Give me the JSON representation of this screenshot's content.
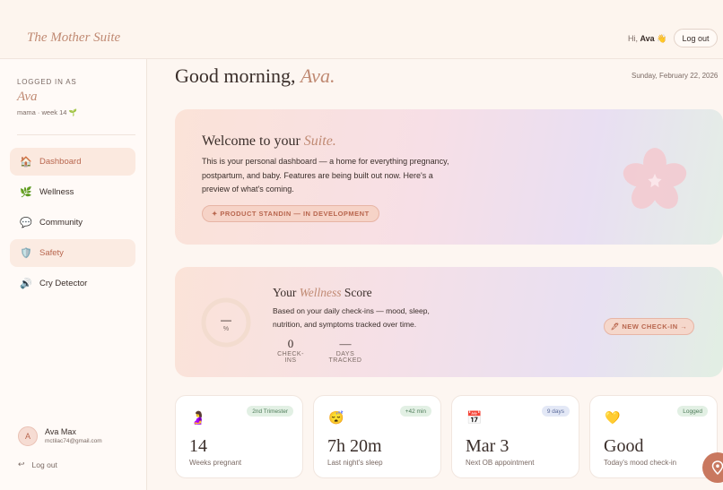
{
  "brand": "The Mother Suite",
  "header": {
    "greeting_prefix": "Hi,",
    "user": "Ava",
    "wave": "👋",
    "logout": "Log out"
  },
  "sidebar": {
    "logged_in_label": "LOGGED IN AS",
    "name": "Ava",
    "sub": "mama · week 14 🌱",
    "items": [
      {
        "label": "Dashboard",
        "icon": "🏠"
      },
      {
        "label": "Wellness",
        "icon": "🌿"
      },
      {
        "label": "Community",
        "icon": "💬"
      },
      {
        "label": "Safety",
        "icon": "🛡️"
      },
      {
        "label": "Cry Detector",
        "icon": "🔊"
      }
    ],
    "account": {
      "initial": "A",
      "name": "Ava Max",
      "email": "mctilac74@gmail.com"
    },
    "logout": "Log out"
  },
  "main": {
    "greeting": "Good morning,",
    "greeting_name": "Ava.",
    "date": "Sunday, February 22, 2026",
    "welcome": {
      "title": "Welcome to your",
      "title_accent": "Suite.",
      "body": "This is your personal dashboard — a home for everything pregnancy, postpartum, and baby. Features are being built out now. Here's a preview of what's coming.",
      "pill": "✦ PRODUCT STANDIN — IN DEVELOPMENT"
    },
    "wellness": {
      "score_value": "—",
      "score_unit": "%",
      "score_fraction": 0,
      "title_prefix": "Your",
      "title_accent": "Wellness",
      "title_suffix": "Score",
      "desc": "Based on your daily check-ins — mood, sleep, nutrition, and symptoms tracked over time.",
      "checkins_value": "0",
      "checkins_label": "CHECK-INS",
      "days_value": "—",
      "days_label": "DAYS TRACKED",
      "button": "🖊 NEW CHECK-IN →"
    },
    "cards": [
      {
        "icon": "🤰",
        "badge": "2nd Trimester",
        "value": "14",
        "label": "Weeks pregnant"
      },
      {
        "icon": "😴",
        "badge": "+42 min",
        "value": "7h 20m",
        "label": "Last night's sleep"
      },
      {
        "icon": "📅",
        "badge": "9 days",
        "value": "Mar 3",
        "label": "Next OB appointment"
      },
      {
        "icon": "💛",
        "badge": "Logged",
        "value": "Good",
        "label": "Today's mood check-in"
      }
    ]
  },
  "colors": {
    "accent": "#c08a73",
    "accent_dark": "#b8664e",
    "badge_green": "#4f7c5a"
  }
}
